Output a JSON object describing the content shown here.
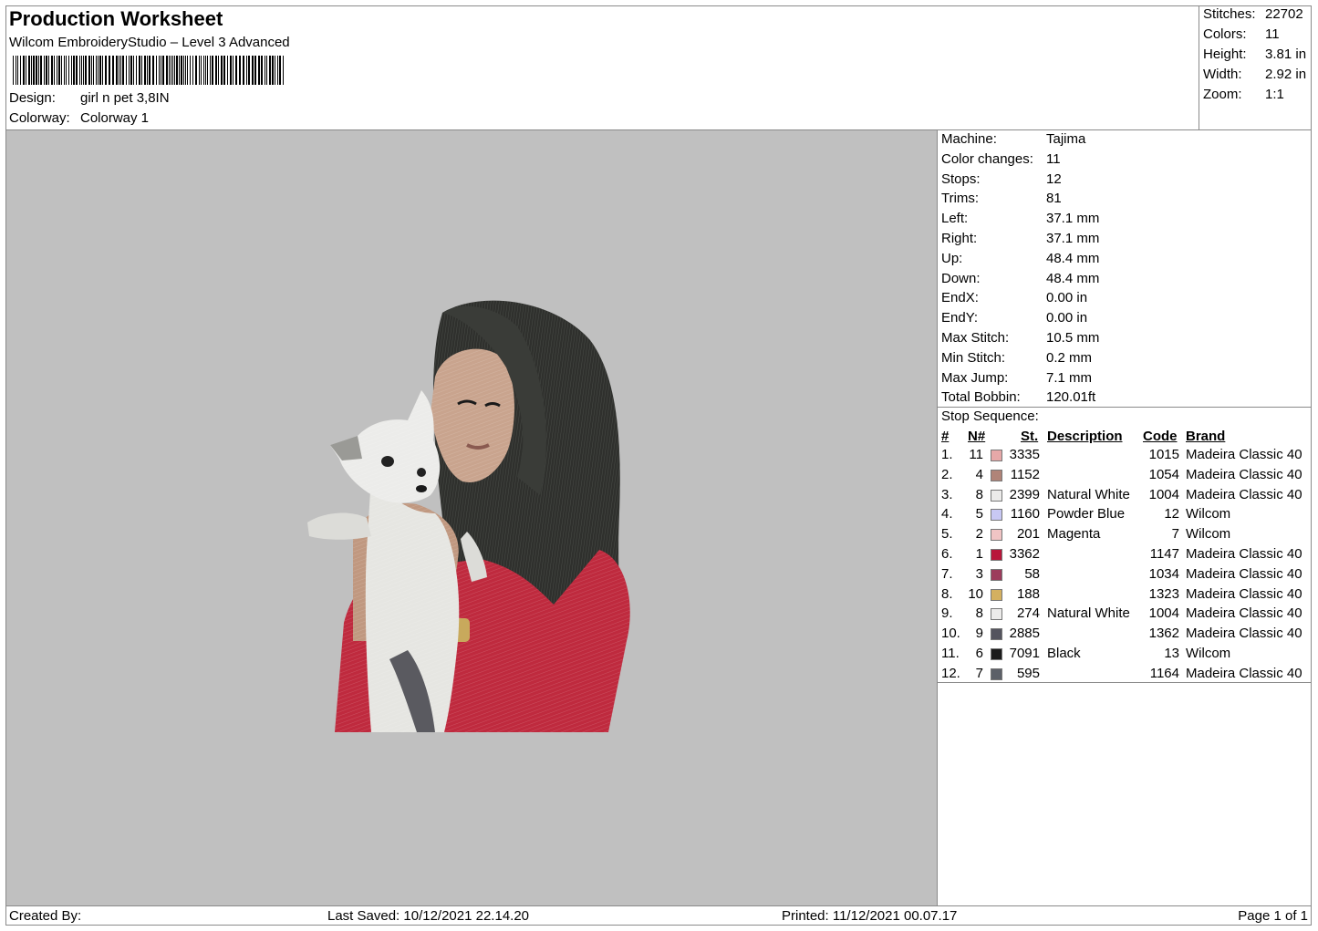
{
  "header": {
    "title": "Production Worksheet",
    "software": "Wilcom EmbroideryStudio – Level 3 Advanced",
    "design_label": "Design:",
    "design_value": "girl n pet 3,8IN",
    "colorway_label": "Colorway:",
    "colorway_value": "Colorway 1"
  },
  "stats": [
    {
      "label": "Stitches:",
      "value": "22702"
    },
    {
      "label": "Colors:",
      "value": "11"
    },
    {
      "label": "Height:",
      "value": "3.81 in"
    },
    {
      "label": "Width:",
      "value": "2.92 in"
    },
    {
      "label": "Zoom:",
      "value": "1:1"
    }
  ],
  "machine_info": [
    {
      "label": "Machine:",
      "value": "Tajima"
    },
    {
      "label": "Color changes:",
      "value": "11"
    },
    {
      "label": "Stops:",
      "value": "12"
    },
    {
      "label": "Trims:",
      "value": "81"
    },
    {
      "label": "Left:",
      "value": "37.1 mm"
    },
    {
      "label": "Right:",
      "value": "37.1 mm"
    },
    {
      "label": "Up:",
      "value": "48.4 mm"
    },
    {
      "label": "Down:",
      "value": "48.4 mm"
    },
    {
      "label": "EndX:",
      "value": "0.00 in"
    },
    {
      "label": "EndY:",
      "value": "0.00 in"
    },
    {
      "label": "Max Stitch:",
      "value": "10.5 mm"
    },
    {
      "label": "Min Stitch:",
      "value": "0.2 mm"
    },
    {
      "label": "Max Jump:",
      "value": "7.1 mm"
    },
    {
      "label": "Total Bobbin:",
      "value": "120.01ft"
    }
  ],
  "stop_sequence": {
    "title": "Stop Sequence:",
    "columns": {
      "num": "#",
      "n": "N#",
      "st": "St.",
      "desc": "Description",
      "code": "Code",
      "brand": "Brand"
    },
    "rows": [
      {
        "num": "1.",
        "n": "11",
        "color": "#e6a8a8",
        "st": "3335",
        "desc": "",
        "code": "1015",
        "brand": "Madeira Classic 40"
      },
      {
        "num": "2.",
        "n": "4",
        "color": "#b08478",
        "st": "1152",
        "desc": "",
        "code": "1054",
        "brand": "Madeira Classic 40"
      },
      {
        "num": "3.",
        "n": "8",
        "color": "#ecebea",
        "st": "2399",
        "desc": "Natural White",
        "code": "1004",
        "brand": "Madeira Classic 40"
      },
      {
        "num": "4.",
        "n": "5",
        "color": "#c8c8f4",
        "st": "1160",
        "desc": "Powder Blue",
        "code": "12",
        "brand": "Wilcom"
      },
      {
        "num": "5.",
        "n": "2",
        "color": "#f0c4c4",
        "st": "201",
        "desc": "Magenta",
        "code": "7",
        "brand": "Wilcom"
      },
      {
        "num": "6.",
        "n": "1",
        "color": "#b8163a",
        "st": "3362",
        "desc": "",
        "code": "1147",
        "brand": "Madeira Classic 40"
      },
      {
        "num": "7.",
        "n": "3",
        "color": "#9c3c5c",
        "st": "58",
        "desc": "",
        "code": "1034",
        "brand": "Madeira Classic 40"
      },
      {
        "num": "8.",
        "n": "10",
        "color": "#d4b060",
        "st": "188",
        "desc": "",
        "code": "1323",
        "brand": "Madeira Classic 40"
      },
      {
        "num": "9.",
        "n": "8",
        "color": "#ecebea",
        "st": "274",
        "desc": "Natural White",
        "code": "1004",
        "brand": "Madeira Classic 40"
      },
      {
        "num": "10.",
        "n": "9",
        "color": "#54545e",
        "st": "2885",
        "desc": "",
        "code": "1362",
        "brand": "Madeira Classic 40"
      },
      {
        "num": "11.",
        "n": "6",
        "color": "#1a1a1a",
        "st": "7091",
        "desc": "Black",
        "code": "13",
        "brand": "Wilcom"
      },
      {
        "num": "12.",
        "n": "7",
        "color": "#5c6068",
        "st": "595",
        "desc": "",
        "code": "1164",
        "brand": "Madeira Classic 40"
      }
    ]
  },
  "footer": {
    "created_by": "Created By:",
    "last_saved": "Last Saved: 10/12/2021 22.14.20",
    "printed": "Printed: 11/12/2021 00.07.17",
    "page": "Page 1 of 1"
  },
  "canvas": {
    "background": "#c0c0c0"
  }
}
